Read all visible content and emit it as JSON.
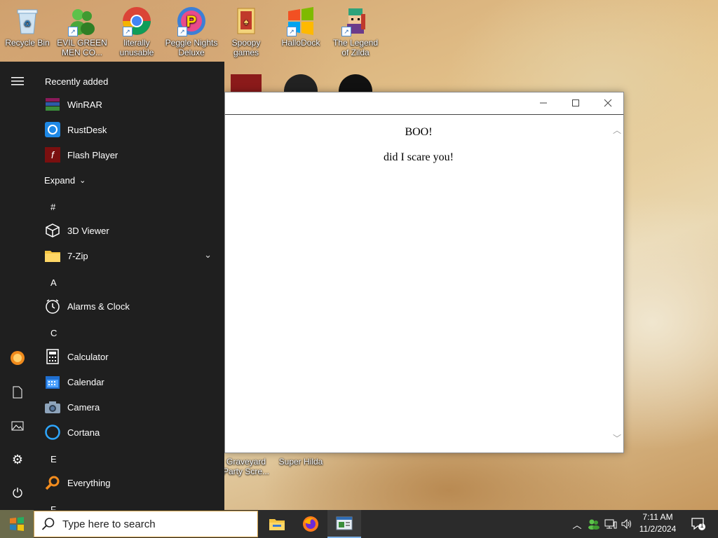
{
  "desktop": {
    "icons": [
      {
        "label": "Recycle Bin",
        "icon": "recycle-bin-icon"
      },
      {
        "label": "EVIL GREEN MEN CO...",
        "icon": "evil-green-men-icon"
      },
      {
        "label": "literally unusable",
        "icon": "chrome-icon"
      },
      {
        "label": "Peggle Nights Deluxe",
        "icon": "peggle-icon"
      },
      {
        "label": "Spoopy games",
        "icon": "folder-icon"
      },
      {
        "label": "HalloDock",
        "icon": "windows-logo-icon"
      },
      {
        "label": "The Legend of Zilda",
        "icon": "zilda-icon"
      },
      {
        "label": "Graveyard Party Scre...",
        "icon": "graveyard-icon"
      },
      {
        "label": "Super Hilda",
        "icon": "super-hilda-icon"
      }
    ]
  },
  "start_menu": {
    "recently_added_label": "Recently added",
    "recent_apps": [
      {
        "label": "WinRAR",
        "icon": "winrar-icon",
        "color": "#8b1a5a"
      },
      {
        "label": "RustDesk",
        "icon": "rustdesk-icon",
        "color": "#1e88e5"
      },
      {
        "label": "Flash Player",
        "icon": "flash-player-icon",
        "color": "#b71c1c"
      }
    ],
    "expand_label": "Expand",
    "sections": [
      {
        "letter": "#",
        "apps": [
          {
            "label": "3D Viewer",
            "icon": "cube-icon"
          },
          {
            "label": "7-Zip",
            "icon": "folder-icon"
          }
        ]
      },
      {
        "letter": "A",
        "apps": [
          {
            "label": "Alarms & Clock",
            "icon": "clock-icon"
          }
        ]
      },
      {
        "letter": "C",
        "apps": [
          {
            "label": "Calculator",
            "icon": "calculator-icon"
          },
          {
            "label": "Calendar",
            "icon": "calendar-icon"
          },
          {
            "label": "Camera",
            "icon": "camera-icon"
          },
          {
            "label": "Cortana",
            "icon": "cortana-icon"
          }
        ]
      },
      {
        "letter": "E",
        "apps": [
          {
            "label": "Everything",
            "icon": "search-icon"
          }
        ]
      },
      {
        "letter": "F",
        "apps": []
      }
    ]
  },
  "window": {
    "heading": "BOO!",
    "body": "did I scare you!"
  },
  "taskbar": {
    "search_placeholder": "Type here to search",
    "clock_time": "7:11 AM",
    "clock_date": "11/2/2024",
    "notification_count": "1"
  }
}
